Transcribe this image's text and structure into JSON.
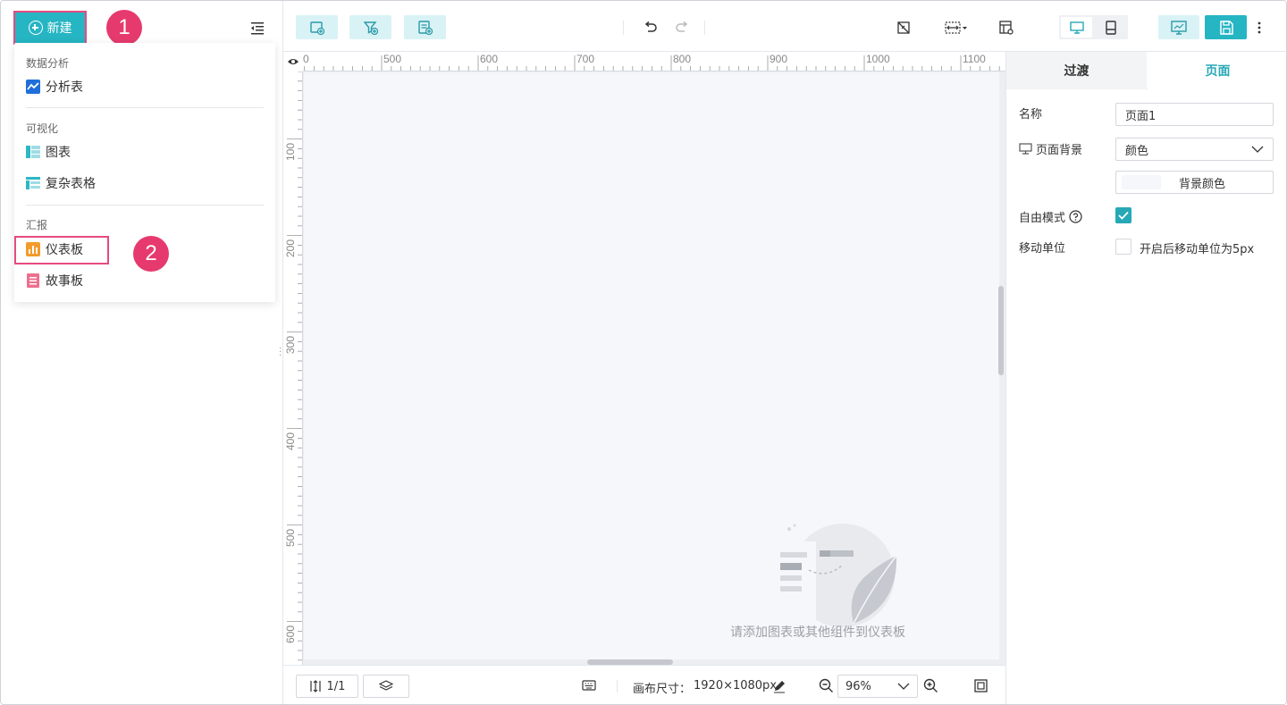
{
  "left": {
    "new_button": "新建",
    "badge1": "1",
    "badge2": "2",
    "menu": {
      "group1": "数据分析",
      "item_analysis": "分析表",
      "group2": "可视化",
      "item_chart": "图表",
      "item_complex_table": "复杂表格",
      "group3": "汇报",
      "item_dashboard": "仪表板",
      "item_storyboard": "故事板"
    }
  },
  "ruler": {
    "top_ticks": [
      "500",
      "600",
      "700",
      "800",
      "900",
      "1000",
      "1100"
    ],
    "left_ticks": [
      "100",
      "200",
      "300",
      "400",
      "500",
      "600"
    ]
  },
  "canvas": {
    "empty_text": "请添加图表或其他组件到仪表板"
  },
  "bottom": {
    "page_indicator": "1/1",
    "canvas_size_label": "画布尺寸：",
    "canvas_size_value": "1920×1080px",
    "zoom": "96%"
  },
  "right": {
    "tab_transition": "过渡",
    "tab_page": "页面",
    "name_label": "名称",
    "name_value": "页面1",
    "bg_label": "页面背景",
    "bg_type": "颜色",
    "bg_color_button": "背景颜色",
    "free_mode_label": "自由模式",
    "move_unit_label": "移动单位",
    "move_unit_option": "开启后移动单位为5px"
  },
  "colors": {
    "accent": "#26b5c3",
    "highlight": "#e64a80",
    "badge": "#e63a6e"
  }
}
